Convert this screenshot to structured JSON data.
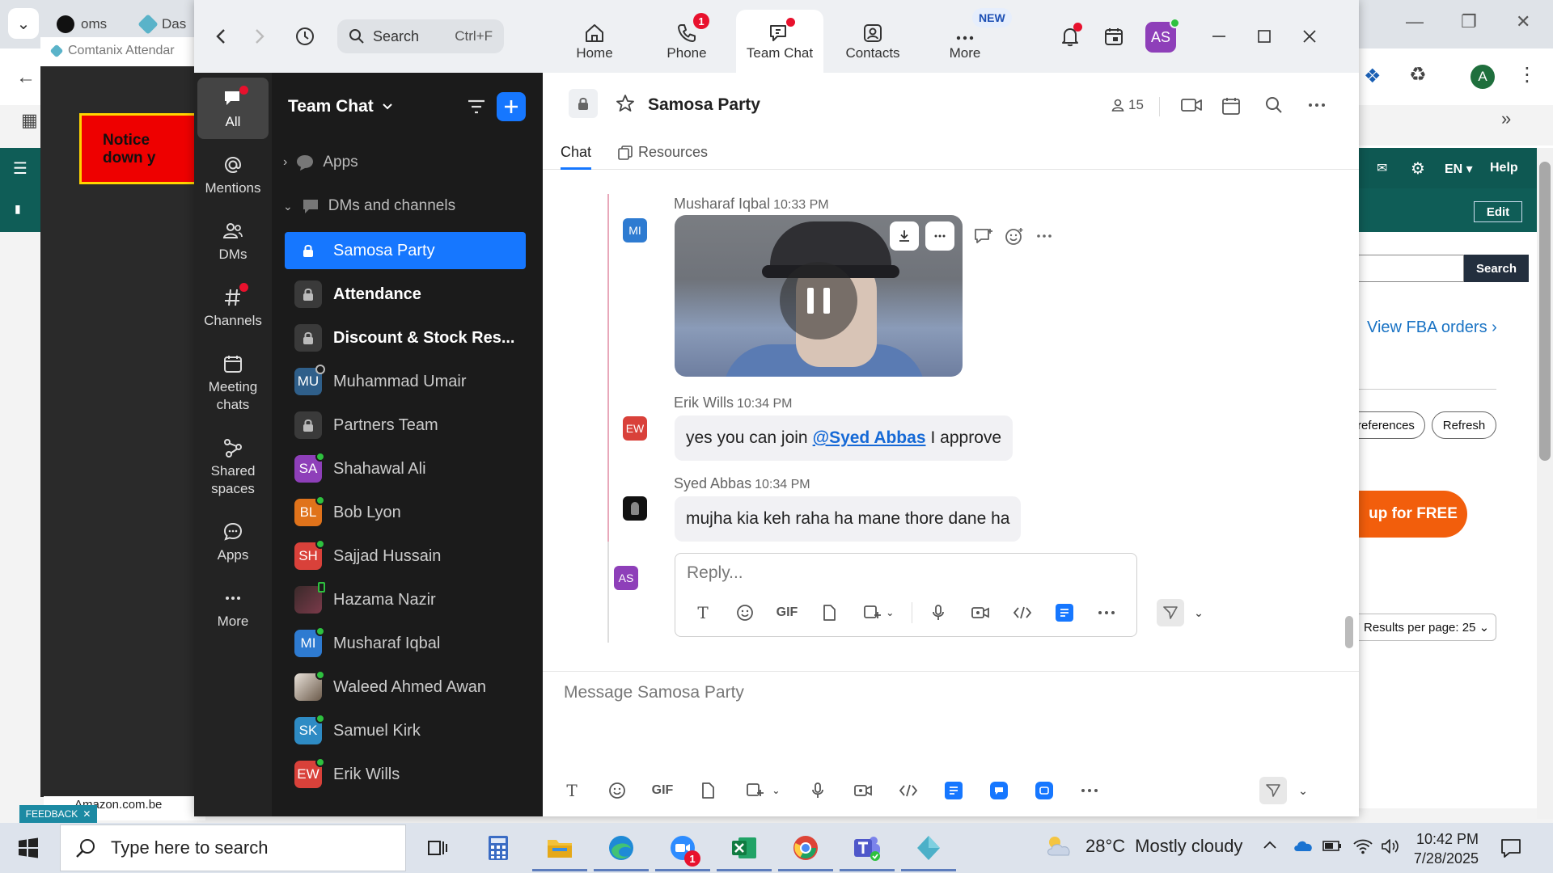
{
  "bg_browser": {
    "tabs": [
      "oms",
      "Das"
    ],
    "popup_title": "Comtanix Attendar",
    "notice_line1": "Notice",
    "notice_line2": "down y",
    "right_panel": {
      "lang": "EN",
      "help": "Help",
      "edit": "Edit",
      "search_btn": "Search",
      "fba_link": "View FBA orders",
      "preferences": "references",
      "refresh": "Refresh",
      "signup": "up for FREE",
      "results_per_page": "Results per page: 25"
    },
    "bottom_link": "Amazon.com.be",
    "feedback": "FEEDBACK",
    "avatar_letter": "A"
  },
  "zoom": {
    "search": {
      "placeholder": "Search",
      "shortcut": "Ctrl+F"
    },
    "top_tabs": [
      {
        "label": "Home",
        "icon": "home-icon"
      },
      {
        "label": "Phone",
        "icon": "phone-icon",
        "badge": "1"
      },
      {
        "label": "Team Chat",
        "icon": "team-chat-icon"
      },
      {
        "label": "Contacts",
        "icon": "contacts-icon"
      },
      {
        "label": "More",
        "icon": "more-icon",
        "new_badge": "NEW"
      }
    ],
    "user_initials": "AS",
    "left_nav": [
      {
        "label": "All"
      },
      {
        "label": "Mentions"
      },
      {
        "label": "DMs"
      },
      {
        "label": "Channels"
      },
      {
        "label": "Meeting chats"
      },
      {
        "label": "Shared spaces"
      },
      {
        "label": "Apps"
      },
      {
        "label": "More"
      }
    ],
    "sidebar": {
      "title": "Team Chat",
      "sections": {
        "apps": "Apps",
        "dms": "DMs and channels"
      },
      "items": [
        {
          "name": "Samosa Party",
          "initials": "",
          "color": "#1677ff"
        },
        {
          "name": "Attendance",
          "initials": "",
          "color": "#3a3a3a"
        },
        {
          "name": "Discount & Stock Res...",
          "initials": "",
          "color": "#3a3a3a"
        },
        {
          "name": "Muhammad Umair",
          "initials": "MU",
          "color": "#2f5f8a"
        },
        {
          "name": "Partners Team",
          "initials": "",
          "color": "#3a3a3a"
        },
        {
          "name": "Shahawal Ali",
          "initials": "SA",
          "color": "#8e3fb9"
        },
        {
          "name": "Bob Lyon",
          "initials": "BL",
          "color": "#e0731b"
        },
        {
          "name": "Sajjad Hussain",
          "initials": "SH",
          "color": "#d9413a"
        },
        {
          "name": "Hazama Nazir",
          "initials": "",
          "color": "#5a2a3a"
        },
        {
          "name": "Musharaf Iqbal",
          "initials": "MI",
          "color": "#2e7bd1"
        },
        {
          "name": "Waleed Ahmed Awan",
          "initials": "",
          "color": "#6b5a4a"
        },
        {
          "name": "Samuel Kirk",
          "initials": "SK",
          "color": "#2e8bc4"
        },
        {
          "name": "Erik Wills",
          "initials": "EW",
          "color": "#d9413a"
        }
      ]
    },
    "chat": {
      "title": "Samosa Party",
      "member_count": "15",
      "tabs": {
        "chat": "Chat",
        "resources": "Resources"
      },
      "messages": [
        {
          "sender": "Musharaf Iqbal",
          "initials": "MI",
          "time": "10:33 PM",
          "type": "video"
        },
        {
          "sender": "Erik Wills",
          "initials": "EW",
          "time": "10:34 PM",
          "text_before": "yes you can join",
          "mention": "@Syed Abbas",
          "text_after": "I approve"
        },
        {
          "sender": "Syed Abbas",
          "initials": "",
          "time": "10:34 PM",
          "text": "mujha kia keh raha ha mane thore dane ha"
        }
      ],
      "reply_placeholder": "Reply...",
      "composer_placeholder": "Message Samosa Party",
      "gif_label": "GIF"
    }
  },
  "taskbar": {
    "search_placeholder": "Type here to search",
    "temperature": "28°C",
    "weather": "Mostly cloudy",
    "time": "10:42 PM",
    "date": "7/28/2025",
    "zoom_badge": "1"
  }
}
